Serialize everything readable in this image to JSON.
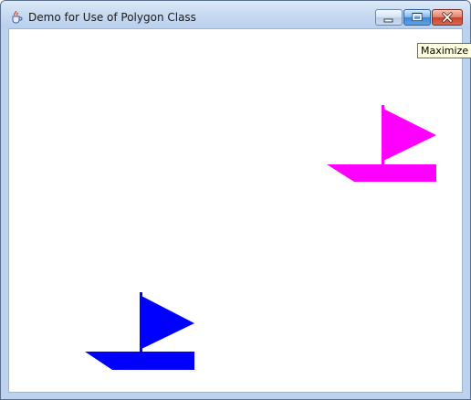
{
  "window": {
    "title": "Demo for Use of Polygon Class",
    "app_icon": "java-cup-icon",
    "controls": {
      "minimize_icon": "minimize-icon",
      "maximize_icon": "maximize-icon",
      "close_icon": "close-icon"
    },
    "tooltip": "Maximize"
  },
  "canvas": {
    "background": "#ffffff",
    "boats": [
      {
        "name": "magenta-sailboat",
        "color": "#ff00ff"
      },
      {
        "name": "blue-sailboat",
        "color": "#0000ff"
      }
    ]
  },
  "colors": {
    "titlebar": "#c6d9f1",
    "window_frame": "#bcd3ef",
    "tooltip_bg": "#ffffe1"
  }
}
